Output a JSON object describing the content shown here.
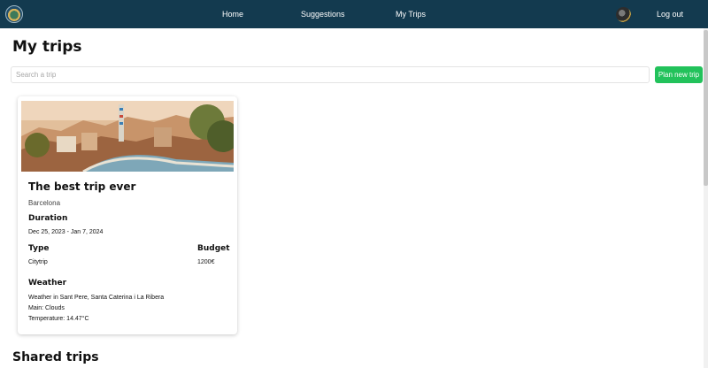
{
  "nav": {
    "home": "Home",
    "suggestions": "Suggestions",
    "my_trips": "My Trips",
    "logout": "Log out"
  },
  "page": {
    "title": "My trips",
    "shared_title": "Shared trips"
  },
  "search": {
    "placeholder": "Search a trip",
    "value": ""
  },
  "plan_button": "Plan new trip",
  "trip": {
    "title": "The best trip ever",
    "city": "Barcelona",
    "duration_label": "Duration",
    "duration": "Dec 25, 2023 - Jan 7, 2024",
    "type_label": "Type",
    "type": "Citytrip",
    "budget_label": "Budget",
    "budget": "1200€",
    "weather_label": "Weather",
    "weather_location": "Weather in Sant Pere, Santa Caterina i La Ribera",
    "weather_main": "Main: Clouds",
    "weather_temp": "Temperature: 14.47°C"
  },
  "colors": {
    "navbar": "#133a4f",
    "primary_button": "#22c25b"
  },
  "icons": {
    "logo": "globe-logo",
    "avatar": "user-avatar"
  }
}
